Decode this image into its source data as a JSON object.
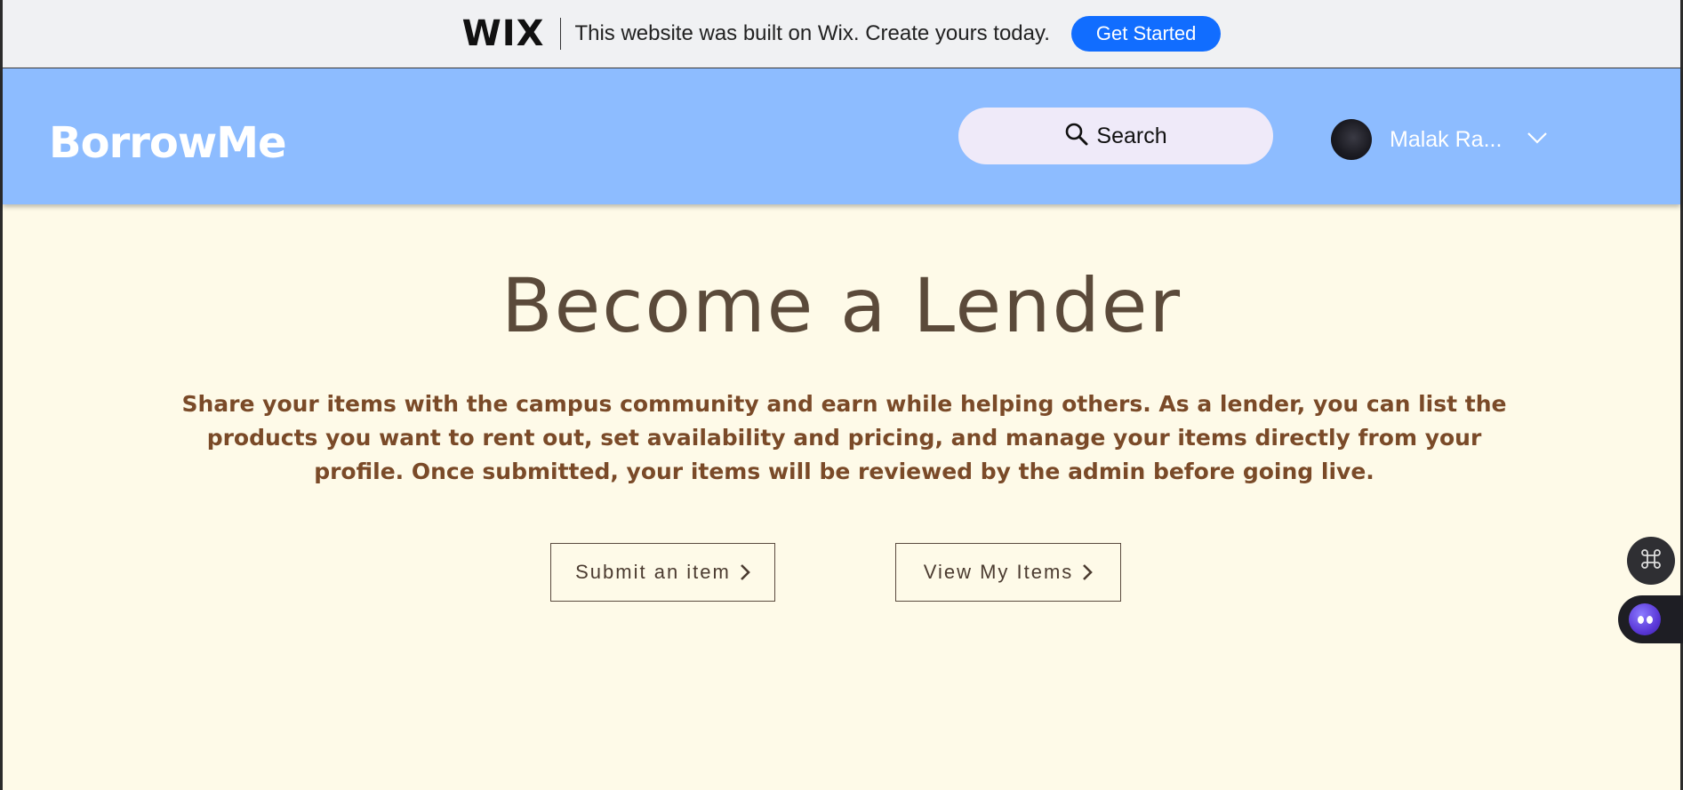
{
  "wix_banner": {
    "logo": "WIX",
    "text": "This website was built on Wix. Create yours today.",
    "cta_label": "Get Started",
    "cta_color": "#116dff"
  },
  "header": {
    "brand": "BorrowMe",
    "search_label": "Search",
    "user_name": "Malak Ra...",
    "background_color": "#8dbcff"
  },
  "main": {
    "title": "Become a Lender",
    "description": "Share your items with the campus community and earn while helping others. As a lender, you can list the products you want to rent out, set availability and pricing, and manage your items directly from your profile. Once submitted, your items will be reviewed by the admin before going live.",
    "buttons": {
      "submit_label": "Submit an item",
      "view_label": "View My Items"
    }
  },
  "icons": {
    "search": "search-icon",
    "chevron": "chevron-down-icon",
    "arrow": "chevron-right-icon",
    "command": "command-icon",
    "chat": "chat-assistant-icon"
  }
}
